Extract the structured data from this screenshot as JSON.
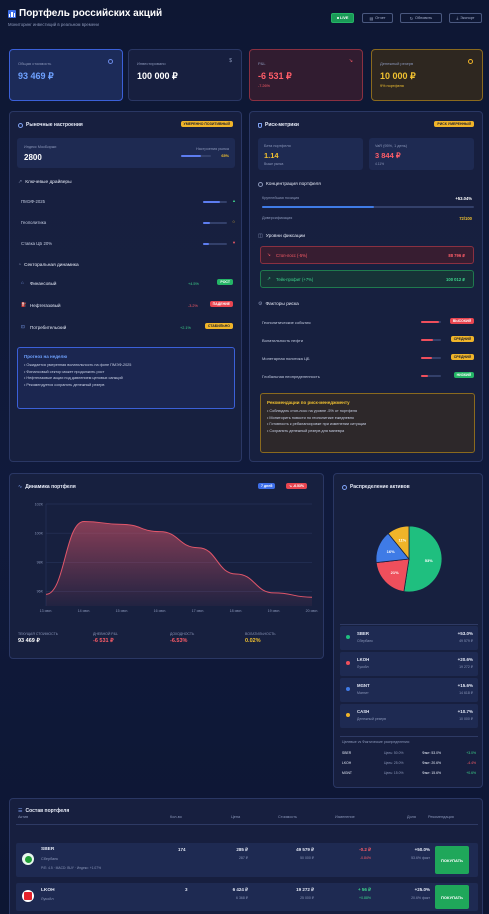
{
  "header": {
    "title": "Портфель российских акций",
    "subtitle": "Мониторинг инвестиций в реальном времени",
    "live_label": "LIVE",
    "btn_report": "Отчет",
    "btn_update": "Обновить",
    "btn_export": "Экспорт"
  },
  "stats": [
    {
      "label": "Общая стоимость",
      "value": "93 469 ₽",
      "sub": ""
    },
    {
      "label": "Инвестировано",
      "value": "100 000 ₽",
      "sub": ""
    },
    {
      "label": "P&L",
      "value": "-6 531 ₽",
      "sub": "-7.26%"
    },
    {
      "label": "Денежный резерв",
      "value": "10 000 ₽",
      "sub": "9% портфеля"
    }
  ],
  "market": {
    "title": "Рыночные настроения",
    "badge": "УМЕРЕННО ПОЗИТИВНЫЙ",
    "index_label": "Индекс МосБиржи",
    "index_value": "2800",
    "sentiment_label": "Настроения рынка",
    "sentiment_value": "65%",
    "sentiment_level": 0.65,
    "drivers_title": "Ключевые драйверы",
    "drivers": [
      {
        "label": "ПМЭФ-2025",
        "level": 0.7
      },
      {
        "label": "Геополитика",
        "level": 0.3
      },
      {
        "label": "Ставка ЦБ 20%",
        "level": 0.25
      }
    ],
    "sectors_title": "Секторальная динамика",
    "sectors": [
      {
        "label": "Финансовый",
        "change": "+4.5%",
        "status": "РОСТ"
      },
      {
        "label": "Нефтегазовый",
        "change": "-3.2%",
        "status": "ПАДЕНИЕ"
      },
      {
        "label": "Потребительский",
        "change": "+2.1%",
        "status": "СТАБИЛЬНО"
      }
    ],
    "forecast_title": "Прогноз на неделю",
    "forecast": [
      "Ожидается умеренная волатильность на фоне ПМЭФ-2025",
      "Финансовый сектор может продолжить рост",
      "Нефтегазовые акции под давлением ценовых санкций",
      "Рекомендуется сохранять денежный резерв"
    ]
  },
  "risk": {
    "title": "Риск-метрики",
    "badge": "РИСК УМЕРЕННЫЙ",
    "beta_label": "Бета портфеля",
    "beta_value": "1.14",
    "beta_sub": "Выше рынка",
    "var_label": "VaR (95%, 1 день)",
    "var_value": "3 844 ₽",
    "var_sub": "4.11%",
    "concentration_title": "Концентрация портфеля",
    "largest_label": "Крупнейшая позиция",
    "largest_value": "+53.04%",
    "largest_level": 0.53,
    "diversification_label": "Диверсификация",
    "diversification_value": "72/100",
    "fix_title": "Уровни фиксации",
    "stop_label": "Стоп-лосс (-5%)",
    "stop_value": "88 796 ₽",
    "take_label": "Тейк-профит (+7%)",
    "take_value": "100 012 ₽",
    "factors_title": "Факторы риска",
    "factors": [
      {
        "label": "Геополитические события",
        "status": "ВЫСОКИЙ",
        "level": 0.9
      },
      {
        "label": "Волатильность нефти",
        "status": "СРЕДНИЙ",
        "level": 0.6
      },
      {
        "label": "Монетарная политика ЦБ",
        "status": "СРЕДНИЙ",
        "level": 0.55
      },
      {
        "label": "Глобальная неопределенность",
        "status": "НИЗКИЙ",
        "level": 0.35
      }
    ],
    "rec_title": "Рекомендации по риск-менеджменту",
    "recommendations": [
      "Соблюдать стоп-лосс на уровне -5% от портфеля",
      "Мониторить новости по геополитике ежедневно",
      "Готовность к ребалансировке при изменении ситуации",
      "Сохранять денежный резерв для маневра"
    ]
  },
  "dynamics": {
    "title": "Динамика портфеля",
    "period_label": "7 дней",
    "change_label": "-6.53%",
    "stats": [
      {
        "label": "ТЕКУЩАЯ СТОИМОСТЬ",
        "value": "93 469 ₽"
      },
      {
        "label": "ДНЕВНОЙ P&L",
        "value": "-6 531 ₽"
      },
      {
        "label": "ДОХОДНОСТЬ",
        "value": "-6.53%"
      },
      {
        "label": "ВОЛАТИЛЬНОСТЬ",
        "value": "0.02%"
      }
    ]
  },
  "chart_data": {
    "type": "area",
    "x": [
      "13 июн.",
      "14 июн.",
      "15 июн.",
      "16 июн.",
      "17 июн.",
      "18 июн.",
      "19 июн.",
      "20 июн."
    ],
    "y_ticks": [
      "102K",
      "100K",
      "98K",
      "96K"
    ],
    "ylim": [
      95000,
      102000
    ],
    "values": [
      95800,
      100800,
      100600,
      100100,
      99000,
      97200,
      95900,
      95600
    ],
    "line_color": "#e0566a"
  },
  "allocation": {
    "title": "Распределение активов",
    "pie": [
      {
        "label": "53%",
        "value": 53,
        "color": "#1fbf7f"
      },
      {
        "label": "21%",
        "value": 21,
        "color": "#ef4f5c"
      },
      {
        "label": "16%",
        "value": 16,
        "color": "#3f7be6"
      },
      {
        "label": "11%",
        "value": 11,
        "color": "#f0b429"
      }
    ],
    "items": [
      {
        "ticker": "SBER",
        "name": "Сбербанк",
        "pct": "+53.0%",
        "amount": "49 579 ₽",
        "color": "#1fbf7f"
      },
      {
        "ticker": "LKOH",
        "name": "Лукойл",
        "pct": "+20.6%",
        "amount": "19 272 ₽",
        "color": "#ef4f5c"
      },
      {
        "ticker": "MGNT",
        "name": "Магнит",
        "pct": "+15.6%",
        "amount": "14 618 ₽",
        "color": "#3f7be6"
      },
      {
        "ticker": "CASH",
        "name": "Денежный резерв",
        "pct": "+10.7%",
        "amount": "10 000 ₽",
        "color": "#f0b429"
      }
    ],
    "target_title": "Целевые vs Фактические распределения:",
    "targets": [
      {
        "ticker": "SBER",
        "target": "Цель: 50.0%",
        "fact": "Факт: 53.0%",
        "delta": "+3.0%"
      },
      {
        "ticker": "LKOH",
        "target": "Цель: 25.0%",
        "fact": "Факт: 20.6%",
        "delta": "-4.4%"
      },
      {
        "ticker": "MGNT",
        "target": "Цель: 15.0%",
        "fact": "Факт: 15.6%",
        "delta": "+0.6%"
      }
    ]
  },
  "holdings": {
    "title": "Состав портфеля",
    "headers": [
      "Актив",
      "Кол-во",
      "Цена",
      "Стоимость",
      "Изменение",
      "Доля",
      "Рекомендация"
    ],
    "rows": [
      {
        "ticker": "SBER",
        "name": "Сбербанк",
        "meta": "P/E: 4.5 · MACD: BUY · Индекс: +1.07%",
        "qty": "174",
        "price": "285 ₽",
        "price_sub": "287 ₽",
        "value": "49 579 ₽",
        "value_sub": "50 000 ₽",
        "change": "-0.2 ₽",
        "change_sub": "-0.84%",
        "share": "+50.0%",
        "share_sub": "53.6% факт",
        "action": "ПОКУПАТЬ"
      },
      {
        "ticker": "LKOH",
        "name": "Лукойл",
        "meta": "",
        "qty": "3",
        "price": "6 424 ₽",
        "price_sub": "6 368 ₽",
        "value": "19 272 ₽",
        "value_sub": "25 000 ₽",
        "change": "+ 56 ₽",
        "change_sub": "+0.88%",
        "share": "+25.0%",
        "share_sub": "20.6% факт",
        "action": "ПОКУПАТЬ"
      }
    ]
  }
}
